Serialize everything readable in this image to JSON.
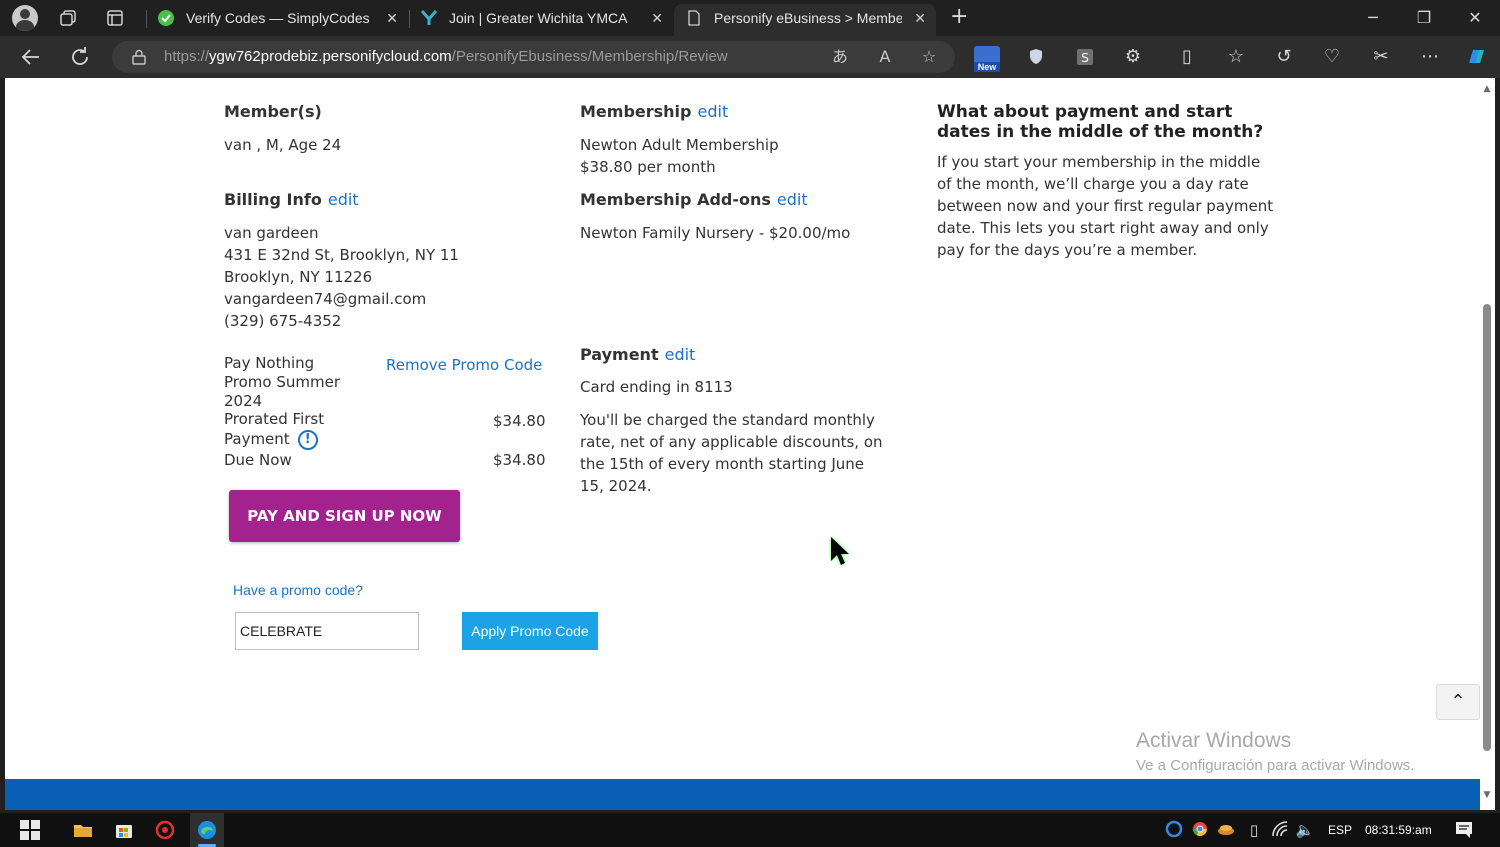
{
  "browser": {
    "tabs": [
      {
        "title": "Verify Codes — SimplyCodes",
        "close": "✕"
      },
      {
        "title": "Join | Greater Wichita YMCA",
        "close": "✕"
      },
      {
        "title": "Personify eBusiness > Membersh",
        "close": "✕"
      }
    ],
    "new_tab": "+",
    "url_prefix": "https://",
    "url_host": "ygw762prodebiz.personifycloud.com",
    "url_path": "/PersonifyEbusiness/Membership/Review",
    "new_badge": "New"
  },
  "page": {
    "members": {
      "heading": "Member(s)",
      "value": "van , M, Age 24"
    },
    "billing": {
      "heading": "Billing Info",
      "edit": "edit",
      "name": "van gardeen",
      "address1": "431 E 32nd St, Brooklyn, NY 11",
      "address2": "Brooklyn, NY 11226",
      "email": "vangardeen74@gmail.com",
      "phone": "(329) 675-4352"
    },
    "promo_summary": {
      "promo_line1": "Pay Nothing",
      "promo_line2": "Promo Summer",
      "promo_line3": "2024",
      "remove_link": "Remove Promo Code",
      "prorated_line1": "Prorated First",
      "prorated_line2": "Payment",
      "prorated_amount": "$34.80",
      "info_icon": "!",
      "due_label": "Due Now",
      "due_amount": "$34.80"
    },
    "pay_button": "PAY AND SIGN UP NOW",
    "promo": {
      "question": "Have a promo code?",
      "input_value": "CELEBRATE",
      "apply_button": "Apply Promo Code"
    },
    "membership": {
      "heading": "Membership",
      "edit": "edit",
      "name": "Newton Adult Membership",
      "price": "$38.80 per month"
    },
    "addons": {
      "heading": "Membership Add-ons",
      "edit": "edit",
      "item": "Newton Family Nursery - $20.00/mo"
    },
    "payment": {
      "heading": "Payment",
      "edit": "edit",
      "card": "Card ending in 8113",
      "note_line1": "You'll be charged the standard monthly",
      "note_line2": "rate, net of any applicable discounts, on",
      "note_line3": "the 15th of every month starting June",
      "note_line4": "15, 2024."
    },
    "sidebar": {
      "title": "What about payment and start dates in the middle of the month?",
      "body": "If you start your membership in the middle of the month, we’ll charge you a day rate between now and your first regular payment date. This lets you start right away and only pay for the days you’re a member."
    },
    "watermark": {
      "line1": "Activar Windows",
      "line2": "Ve a Configuración para activar Windows."
    }
  },
  "taskbar": {
    "language": "ESP",
    "time": "08:31:59:am"
  },
  "colors": {
    "link": "#1a73c7",
    "pay_button": "#a3238e",
    "apply_button": "#1ba3e6",
    "footer": "#0a5fb4"
  }
}
